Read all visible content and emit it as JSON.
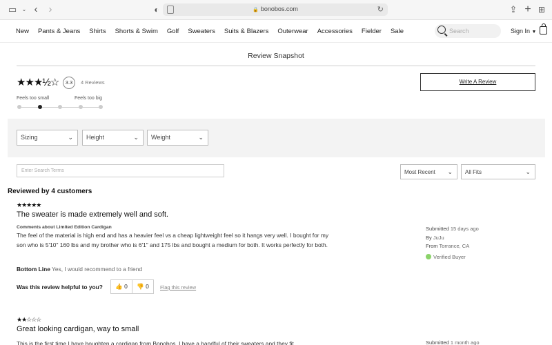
{
  "browser": {
    "domain": "bonobos.com"
  },
  "nav": {
    "links": [
      "New",
      "Pants & Jeans",
      "Shirts",
      "Shorts & Swim",
      "Golf",
      "Sweaters",
      "Suits & Blazers",
      "Outerwear",
      "Accessories",
      "Fielder",
      "Sale"
    ],
    "search_placeholder": "Search",
    "sign_in": "Sign In"
  },
  "snapshot": {
    "title": "Review Snapshot",
    "stars": "★★★½☆",
    "rating": "3.3",
    "review_count": "4 Reviews",
    "fit_left": "Feels too small",
    "fit_right": "Feels too big",
    "fit_level_index": 1,
    "fit_points": 5,
    "write_review": "Write A Review"
  },
  "filters": {
    "sizing": "Sizing",
    "height": "Height",
    "weight": "Weight",
    "search_placeholder": "Enter Search Terms",
    "sort": "Most Recent",
    "fits": "All Fits"
  },
  "reviewed_by": "Reviewed by 4 customers",
  "reviews": [
    {
      "stars": "★★★★★",
      "title": "The sweater is made extremely well and soft.",
      "about": "Comments about Limited Edition Cardigan",
      "body": "The feel of the material is high end and has a heavier feel vs a cheap lightweight feel so it hangs very well. I bought for my son who is 5'10\" 160 lbs and my brother who is 6'1\" and 175 lbs and bought a medium for both. It works perfectly for both.",
      "bottom_line_label": "Bottom Line",
      "bottom_line": "Yes, I would recommend to a friend",
      "helpful_q": "Was this review helpful to you?",
      "up_votes": "0",
      "down_votes": "0",
      "flag": "Flag this review",
      "submitted_label": "Submitted",
      "submitted": "15 days ago",
      "by_label": "By",
      "by": "JuJu",
      "from_label": "From",
      "from": "Torrance, CA",
      "verified": "Verified Buyer"
    },
    {
      "stars": "★★☆☆☆",
      "title": "Great looking cardigan, way to small",
      "body": "This is the first time I have boughten a cardigan from Bonobos. I have a handful of their sweaters and they fit",
      "submitted_label": "Submitted",
      "submitted": "1 month ago"
    }
  ]
}
